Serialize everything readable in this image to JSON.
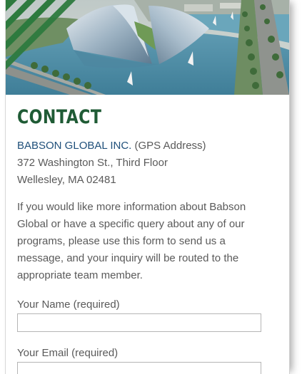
{
  "contact": {
    "title": "CONTACT",
    "org_name": "BABSON GLOBAL INC.",
    "org_note": " (GPS Address)",
    "address_line1": "372 Washington St., Third Floor",
    "address_line2": "Wellesley, MA 02481",
    "intro": "If you would like more information about Babson Global or have a specific query about any of our programs, please use this form to send us a message, and your inquiry will be routed to the appropriate team member."
  },
  "form": {
    "name_label": "Your Name (required)",
    "name_value": "",
    "email_label": "Your Email (required)",
    "email_value": ""
  },
  "colors": {
    "title_green": "#1f5b35",
    "link_blue": "#1f4f7a",
    "body_text": "#5a5a5a",
    "corner_stripe_green": "#2d7a3e"
  },
  "icons": {
    "hero": "futuristic-building-photo",
    "corner": "diagonal-stripes-decoration"
  }
}
